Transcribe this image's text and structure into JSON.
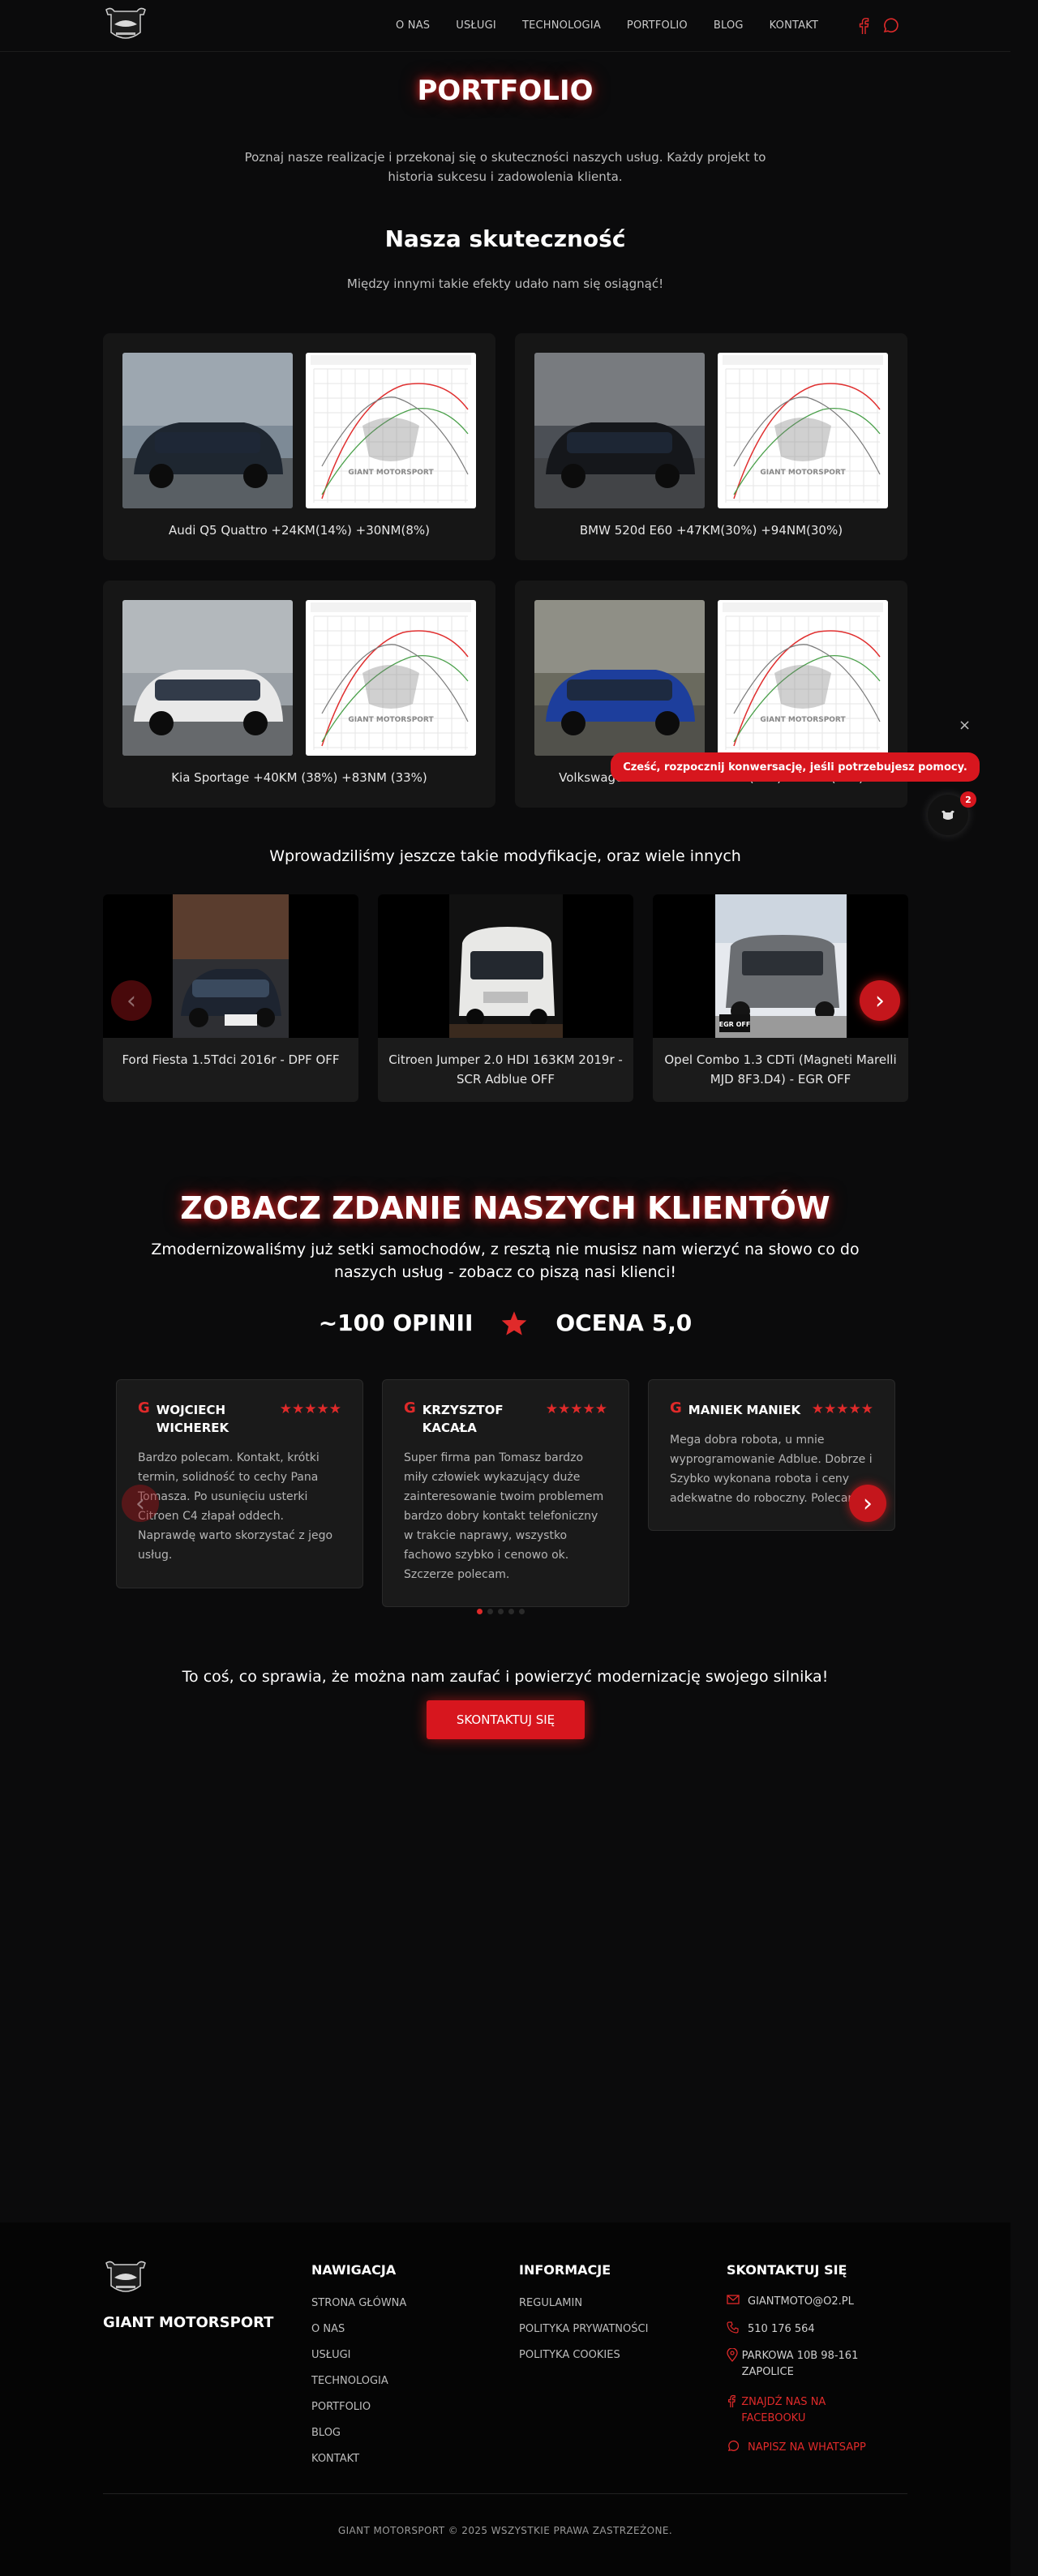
{
  "nav": {
    "links": [
      "O NAS",
      "USŁUGI",
      "TECHNOLOGIA",
      "PORTFOLIO",
      "BLOG",
      "KONTAKT"
    ]
  },
  "hero": {
    "title": "PORTFOLIO",
    "intro": "Poznaj nasze realizacje i przekonaj się o skuteczności naszych usług. Każdy projekt to historia sukcesu i zadowolenia klienta."
  },
  "results": {
    "title": "Nasza skuteczność",
    "subtitle": "Między innymi takie efekty udało nam się osiągnąć!",
    "cards": [
      {
        "caption": "Audi Q5 Quattro +24KM(14%) +30NM(8%)"
      },
      {
        "caption": "BMW 520d E60 +47KM(30%) +94NM(30%)"
      },
      {
        "caption": "Kia Sportage +40KM (38%) +83NM (33%)"
      },
      {
        "caption": "Volkswagen T6 2.0TDI +4...KM (...%) +...NM (...%)"
      }
    ],
    "dyno_label": "GIANT MOTORSPORT"
  },
  "mods": {
    "title": "Wprowadziliśmy jeszcze takie modyfikacje, oraz wiele innych",
    "items": [
      {
        "caption": "Ford Fiesta 1.5Tdci 2016r - DPF OFF"
      },
      {
        "caption": "Citroen Jumper 2.0 HDI 163KM 2019r - SCR Adblue OFF"
      },
      {
        "caption": "Opel Combo 1.3 CDTi (Magneti Marelli MJD 8F3.D4) - EGR OFF"
      }
    ],
    "badge": "EGR OFF"
  },
  "testimonials": {
    "title": "ZOBACZ ZDANIE NASZYCH KLIENTÓW",
    "subtitle": "Zmodernizowaliśmy już setki samochodów, z resztą nie musisz nam wierzyć na słowo co do naszych usług - zobacz co piszą nasi klienci!",
    "opinions": "~100 OPINII",
    "rating": "OCENA 5,0",
    "stars": "★★★★★",
    "reviews": [
      {
        "name": "WOJCIECH WICHEREK",
        "text": "Bardzo polecam. Kontakt, krótki termin, solidność to cechy Pana Tomasza. Po usunięciu usterki Citroen C4 złapał oddech. Naprawdę warto skorzystać z jego usług."
      },
      {
        "name": "KRZYSZTOF KACAŁA",
        "text": "Super firma pan Tomasz bardzo miły człowiek wykazujący duże zainteresowanie twoim problemem bardzo dobry kontakt telefoniczny w trakcie naprawy, wszystko fachowo szybko i cenowo ok. Szczerze polecam."
      },
      {
        "name": "MANIEK MANIEK",
        "text": "Mega dobra robota, u mnie wyprogramowanie Adblue. Dobrze i Szybko wykonana robota i ceny adekwatne do roboczny. Polecam."
      }
    ]
  },
  "cta": {
    "text": "To coś, co sprawia, że można nam zaufać i powierzyć modernizację swojego silnika!",
    "button": "SKONTAKTUJ SIĘ"
  },
  "chat": {
    "bubble": "Cześć, rozpocznij konwersację, jeśli potrzebujesz pomocy.",
    "badge": "2",
    "close": "×"
  },
  "footer": {
    "brand": "GIANT MOTORSPORT",
    "nav_title": "NAWIGACJA",
    "nav_links": [
      "STRONA GŁÓWNA",
      "O NAS",
      "USŁUGI",
      "TECHNOLOGIA",
      "PORTFOLIO",
      "BLOG",
      "KONTAKT"
    ],
    "info_title": "INFORMACJE",
    "info_links": [
      "REGULAMIN",
      "POLITYKA PRYWATNOŚCI",
      "POLITYKA COOKIES"
    ],
    "contact_title": "SKONTAKTUJ SIĘ",
    "email": "GIANTMOTO@O2.PL",
    "phone": "510 176 564",
    "address": "PARKOWA 10B 98-161 ZAPOLICE",
    "facebook": "ZNAJDŹ NAS NA FACEBOOKU",
    "whatsapp": "NAPISZ NA WHATSAPP",
    "copyright": "GIANT MOTORSPORT © 2025 WSZYSTKIE PRAWA ZASTRZEŻONE."
  },
  "colors": {
    "accent": "#e02a2a",
    "background": "#0b0b0c",
    "card": "#161616"
  }
}
